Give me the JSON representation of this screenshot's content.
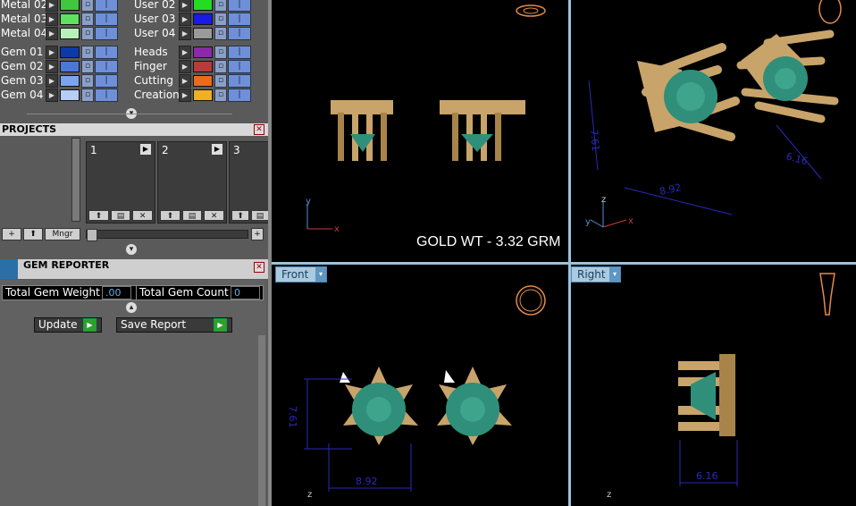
{
  "layers_left": [
    {
      "label": "Metal 02",
      "color": "#3fc83f"
    },
    {
      "label": "Metal 03",
      "color": "#5fe05f"
    },
    {
      "label": "Metal 04",
      "color": "#b8f2b8"
    },
    {
      "label": "Gem 01",
      "color": "#0c3aa8"
    },
    {
      "label": "Gem 02",
      "color": "#4a78d8"
    },
    {
      "label": "Gem 03",
      "color": "#7aa6f0"
    },
    {
      "label": "Gem 04",
      "color": "#b6cdf6"
    }
  ],
  "layers_right": [
    {
      "label": "User 02",
      "color": "#22dd22"
    },
    {
      "label": "User 03",
      "color": "#1a1ae8"
    },
    {
      "label": "User 04",
      "color": "#9a9a9a"
    },
    {
      "label": "Heads",
      "color": "#8a2aa8"
    },
    {
      "label": "Finger",
      "color": "#b83a3a"
    },
    {
      "label": "Cutting",
      "color": "#ee6a18"
    },
    {
      "label": "Creation",
      "color": "#f0b020"
    }
  ],
  "projects": {
    "title": "PROJECTS",
    "cards": [
      "1",
      "2",
      "3"
    ],
    "manager_label": "Mngr"
  },
  "gem_reporter": {
    "title": "GEM REPORTER",
    "total_weight_label": "Total Gem Weight",
    "total_weight_value": ".00",
    "total_count_label": "Total Gem Count",
    "total_count_value": "0",
    "update_label": "Update",
    "save_label": "Save Report"
  },
  "viewports": {
    "gold_weight": "GOLD WT - 3.32 GRM",
    "front_label": "Front",
    "right_label": "Right",
    "dims": {
      "persp_height": "7.61",
      "persp_width": "8.92",
      "persp_depth": "6.16",
      "front_height": "7.61",
      "front_width": "8.92",
      "right_width": "6.16"
    },
    "axes": {
      "x": "x",
      "y": "y",
      "z": "z"
    }
  },
  "colors": {
    "gold": "#c8a46a",
    "gem": "#2f8f7a",
    "dimension_line": "#2a2ab8",
    "viewport_border": "#9bc3dc"
  }
}
